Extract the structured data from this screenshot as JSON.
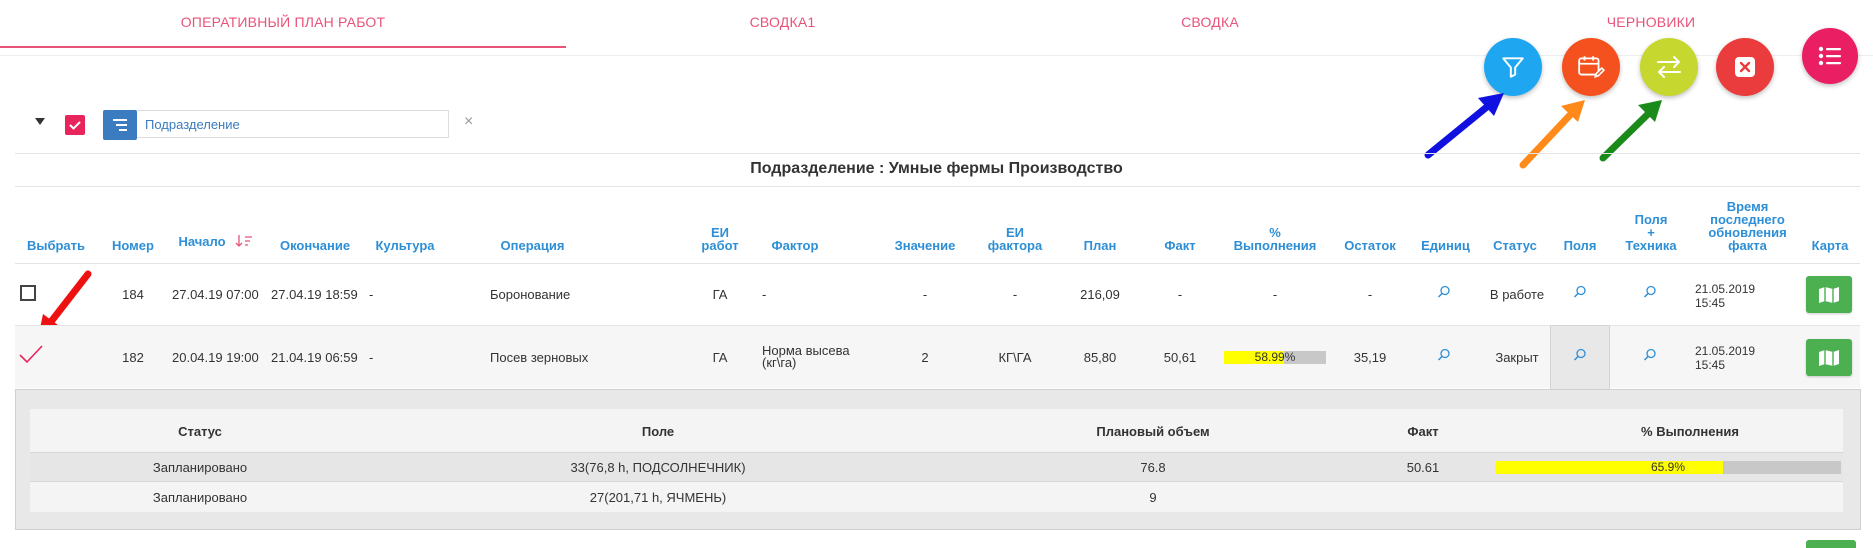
{
  "tabs": [
    {
      "label": "ОПЕРАТИВНЫЙ ПЛАН РАБОТ",
      "active": true
    },
    {
      "label": "СВОДКА1",
      "active": false
    },
    {
      "label": "СВОДКА",
      "active": false
    },
    {
      "label": "ЧЕРНОВИКИ",
      "active": false
    }
  ],
  "fabs": {
    "filter": {
      "icon": "filter-icon",
      "color": "#1ea7f0"
    },
    "calendar": {
      "icon": "calendar-edit-icon",
      "color": "#f4511e"
    },
    "swap": {
      "icon": "swap-arrows-icon",
      "color": "#c6d72f"
    },
    "close": {
      "icon": "close-icon",
      "color": "#ea3c3c"
    },
    "menu": {
      "icon": "list-icon",
      "color": "#e91e63"
    }
  },
  "annotation_arrows": [
    {
      "color": "#1010e0"
    },
    {
      "color": "#ff8a1a"
    },
    {
      "color": "#1a8a1a"
    },
    {
      "color": "#ee1111"
    }
  ],
  "filter": {
    "value": "Подразделение",
    "clear": "×"
  },
  "group_title": "Подразделение : Умные фермы Производство",
  "columns": {
    "select": "Выбрать",
    "number": "Номер",
    "start": "Начало",
    "end": "Окончание",
    "crop": "Культура",
    "operation": "Операция",
    "work_unit": [
      "ЕИ",
      "работ"
    ],
    "factor": "Фактор",
    "value": "Значение",
    "factor_unit": [
      "ЕИ",
      "фактора"
    ],
    "plan": "План",
    "fact": "Факт",
    "completion": [
      "%",
      "Выполнения"
    ],
    "remaining": "Остаток",
    "units": "Единиц",
    "status": "Статус",
    "fields": "Поля",
    "fields_equipment": [
      "Поля",
      "+",
      "Техника"
    ],
    "update_time": [
      "Время",
      "последнего",
      "обновления",
      "факта"
    ],
    "map": "Карта"
  },
  "rows": [
    {
      "number": "184",
      "start": "27.04.19 07:00",
      "end": "27.04.19 18:59",
      "crop": "-",
      "operation": "Боронование",
      "work_unit": "ГА",
      "factor": "-",
      "value": "-",
      "factor_unit": "-",
      "plan": "216,09",
      "fact": "-",
      "completion": "-",
      "remaining": "-",
      "status": "В работе",
      "update_date": "21.05.2019",
      "update_time": "15:45",
      "checked": false
    },
    {
      "number": "182",
      "start": "20.04.19 19:00",
      "end": "21.04.19 06:59",
      "crop": "-",
      "operation": "Посев зерновых",
      "work_unit": "ГА",
      "factor": [
        "Норма высева",
        "(кг\\га)"
      ],
      "value": "2",
      "factor_unit": "КГ\\ГА",
      "plan": "85,80",
      "fact": "50,61",
      "completion": "58.99%",
      "completion_value": 0.5899,
      "remaining": "35,19",
      "status": "Закрыт",
      "update_date": "21.05.2019",
      "update_time": "15:45",
      "checked": true
    }
  ],
  "detail": {
    "columns": {
      "status": "Статус",
      "field": "Поле",
      "planned_volume": "Плановый объем",
      "fact": "Факт",
      "completion": "% Выполнения"
    },
    "rows": [
      {
        "status": "Запланировано",
        "field": "33(76,8 h, ПОДСОЛНЕЧНИК)",
        "planned_volume": "76.8",
        "fact": "50.61",
        "completion": "65.9%",
        "completion_value": 0.659
      },
      {
        "status": "Запланировано",
        "field": "27(201,71 h, ЯЧМЕНЬ)",
        "planned_volume": "9",
        "fact": "",
        "completion": "",
        "completion_value": null
      }
    ]
  },
  "colors": {
    "accent": "#e8537a",
    "link": "#2e8fd6",
    "progress_fill": "#ffff00",
    "progress_track": "#c8c8c8",
    "map_button": "#4caf50"
  }
}
